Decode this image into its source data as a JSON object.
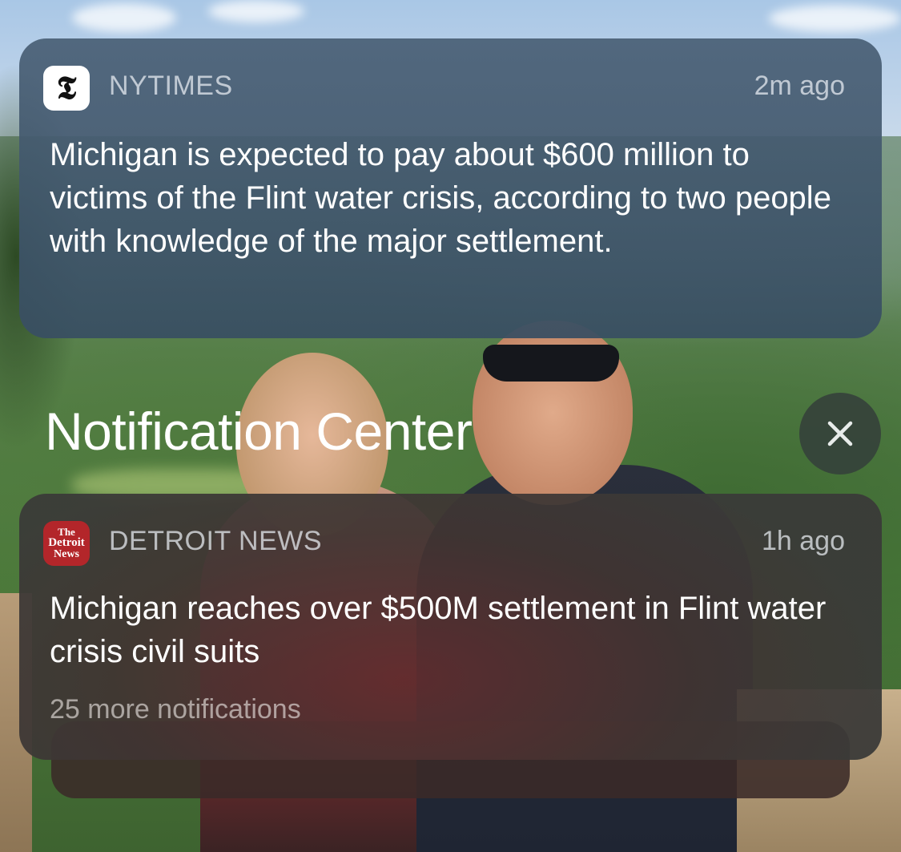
{
  "header": {
    "title": "Notification Center",
    "close_icon": "close-icon"
  },
  "notifications": [
    {
      "app": "NYTIMES",
      "icon": "nytimes-logo-icon",
      "icon_glyph": "𝕿",
      "time": "2m ago",
      "body": "Michigan is expected to pay about $600 million to victims of the Flint water crisis, according to two people with knowledge of the major settlement."
    },
    {
      "app": "DETROIT NEWS",
      "icon": "detroit-news-logo-icon",
      "icon_lines": [
        "The",
        "Detroit",
        "News"
      ],
      "time": "1h ago",
      "body": "Michigan reaches over $500M settlement in Flint water crisis civil suits",
      "more": "25 more notifications"
    }
  ],
  "colors": {
    "card_nyt": "#3e5870",
    "card_detroit": "#4a3434",
    "detroit_brand": "#b3262a"
  }
}
